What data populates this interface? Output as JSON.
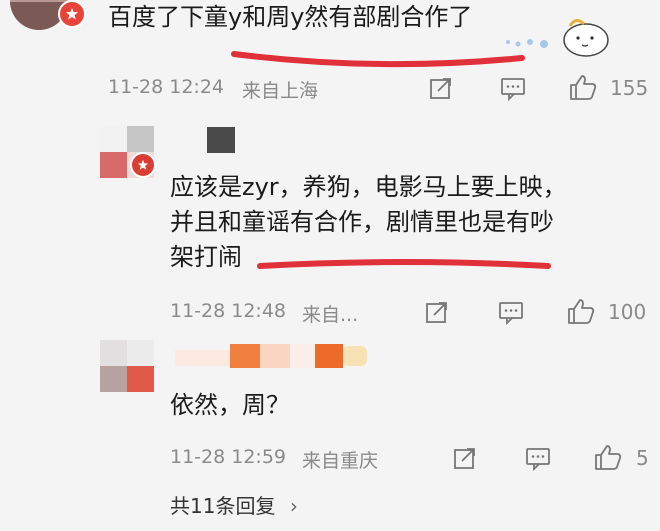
{
  "comments": [
    {
      "text": "百度了下童y和周y然有部剧合作了",
      "time": "11-28 12:24",
      "location": "来自上海",
      "likes": "155"
    },
    {
      "line1": "应该是zyr，养狗，电影马上要上映，",
      "line2": "并且和童谣有合作，剧情里也是有吵",
      "line3": "架打闹",
      "time": "11-28 12:48",
      "location": "来自...",
      "likes": "100"
    },
    {
      "text": "依然，周？",
      "time": "11-28 12:59",
      "location": "来自重庆",
      "likes": "5"
    }
  ],
  "replies": {
    "label": "共11条回复",
    "chevron": "›"
  },
  "icons": {
    "share": "share-icon",
    "comment": "comment-icon",
    "like": "thumbs-up-icon",
    "badge": "verified-badge-icon",
    "sticker": "cartoon-sticker-icon"
  },
  "colors": {
    "accent_underline": "#e0303a",
    "background": "#f4f4f4",
    "meta_text": "#8a8a8a",
    "body_text": "#1b1b1b"
  }
}
